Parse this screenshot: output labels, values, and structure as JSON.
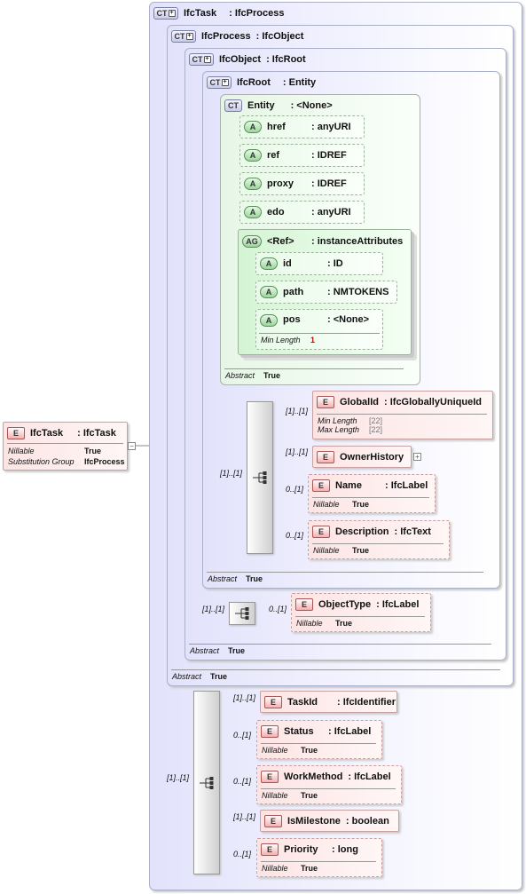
{
  "root": {
    "name": "IfcTask",
    "type": ": IfcTask",
    "props": [
      {
        "k": "Nillable",
        "v": "True"
      },
      {
        "k": "Substitution Group",
        "v": "IfcProcess"
      }
    ]
  },
  "ct_ifctask": {
    "name": "IfcTask",
    "base": ": IfcProcess",
    "abstract_label": "Abstract",
    "abstract_value": "True"
  },
  "ct_ifcprocess": {
    "name": "IfcProcess",
    "base": ": IfcObject",
    "abstract_label": "Abstract",
    "abstract_value": "True"
  },
  "ct_ifcobject": {
    "name": "IfcObject",
    "base": ": IfcRoot",
    "abstract_label": "Abstract",
    "abstract_value": "True"
  },
  "ct_ifcroot": {
    "name": "IfcRoot",
    "base": ": Entity",
    "abstract_label": "Abstract",
    "abstract_value": "True"
  },
  "ct_entity": {
    "name": "Entity",
    "base": ": <None>",
    "abstract_label": "Abstract",
    "abstract_value": "True"
  },
  "badges": {
    "ct": "CT",
    "a": "A",
    "ag": "AG",
    "e": "E"
  },
  "attributes": [
    {
      "name": "href",
      "type": ": anyURI"
    },
    {
      "name": "ref",
      "type": ": IDREF"
    },
    {
      "name": "proxy",
      "type": ": IDREF"
    },
    {
      "name": "edo",
      "type": ": anyURI"
    }
  ],
  "attr_group": {
    "name": "<Ref>",
    "type": ": instanceAttributes",
    "items": [
      {
        "name": "id",
        "type": ": ID"
      },
      {
        "name": "path",
        "type": ": NMTOKENS"
      },
      {
        "name": "pos",
        "type": ": <None>",
        "prop_k": "Min Length",
        "prop_v": "1"
      }
    ]
  },
  "root_elements": [
    {
      "name": "GlobalId",
      "type": ": IfcGloballyUniqueId",
      "card": "[1]..[1]",
      "props": [
        {
          "k": "Min Length",
          "v": "[22]"
        },
        {
          "k": "Max Length",
          "v": "[22]"
        }
      ]
    },
    {
      "name": "OwnerHistory",
      "type": "",
      "card": "[1]..[1]"
    },
    {
      "name": "Name",
      "type": ": IfcLabel",
      "card": "0..[1]",
      "props": [
        {
          "k": "Nillable",
          "v": "True"
        }
      ]
    },
    {
      "name": "Description",
      "type": ": IfcText",
      "card": "0..[1]",
      "props": [
        {
          "k": "Nillable",
          "v": "True"
        }
      ]
    }
  ],
  "root_seq_card": "[1]..[1]",
  "object_elements": [
    {
      "name": "ObjectType",
      "type": ": IfcLabel",
      "card": "0..[1]",
      "props": [
        {
          "k": "Nillable",
          "v": "True"
        }
      ]
    }
  ],
  "object_seq_card": "[1]..[1]",
  "task_elements": [
    {
      "name": "TaskId",
      "type": ": IfcIdentifier",
      "card": "[1]..[1]"
    },
    {
      "name": "Status",
      "type": ": IfcLabel",
      "card": "0..[1]",
      "props": [
        {
          "k": "Nillable",
          "v": "True"
        }
      ]
    },
    {
      "name": "WorkMethod",
      "type": ": IfcLabel",
      "card": "0..[1]",
      "props": [
        {
          "k": "Nillable",
          "v": "True"
        }
      ]
    },
    {
      "name": "IsMilestone",
      "type": ": boolean",
      "card": "[1]..[1]"
    },
    {
      "name": "Priority",
      "type": ": long",
      "card": "0..[1]",
      "props": [
        {
          "k": "Nillable",
          "v": "True"
        }
      ]
    }
  ],
  "task_seq_card": "[1]..[1]",
  "expand_symbol": "+",
  "collapse_symbol": "−"
}
